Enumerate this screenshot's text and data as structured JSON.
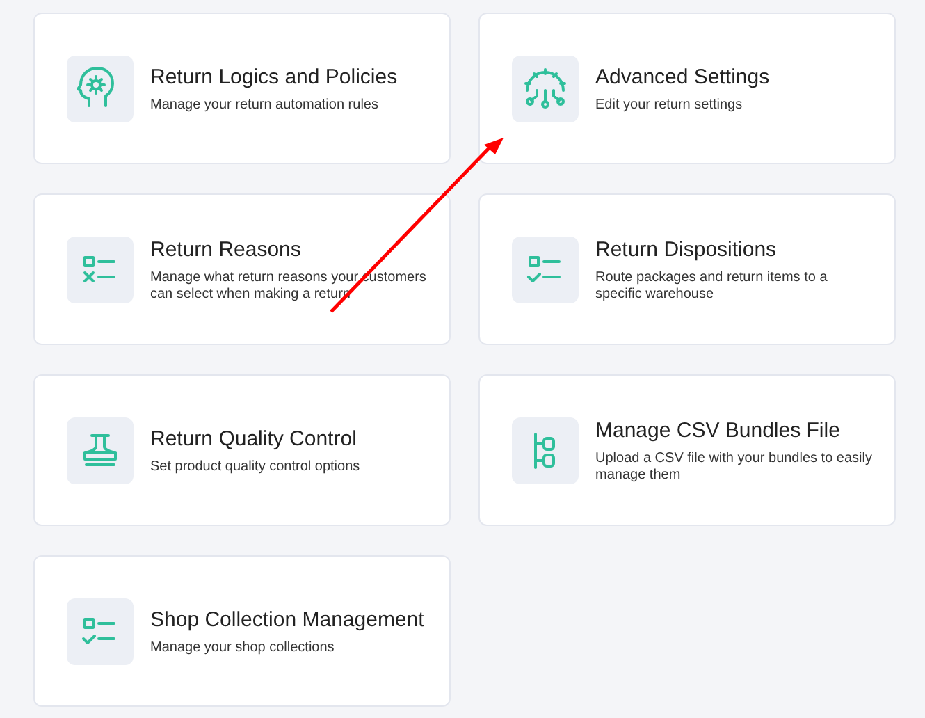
{
  "cards": [
    {
      "kind": "head-gear",
      "title": "Return Logics and Policies",
      "description": "Manage your return automation rules"
    },
    {
      "kind": "gear-circuit",
      "title": "Advanced Settings",
      "description": "Edit your return settings"
    },
    {
      "kind": "list-cross",
      "title": "Return Reasons",
      "description": "Manage what return reasons your customers can select when making a return"
    },
    {
      "kind": "list-check",
      "title": "Return Dispositions",
      "description": "Route packages and return items to a specific warehouse"
    },
    {
      "kind": "stamp",
      "title": "Return Quality Control",
      "description": "Set product quality control options"
    },
    {
      "kind": "tree",
      "title": "Manage CSV Bundles File",
      "description": "Upload a CSV file with your bundles to easily manage them"
    },
    {
      "kind": "list-check",
      "title": "Shop Collection Management",
      "description": "Manage your shop collections"
    }
  ]
}
